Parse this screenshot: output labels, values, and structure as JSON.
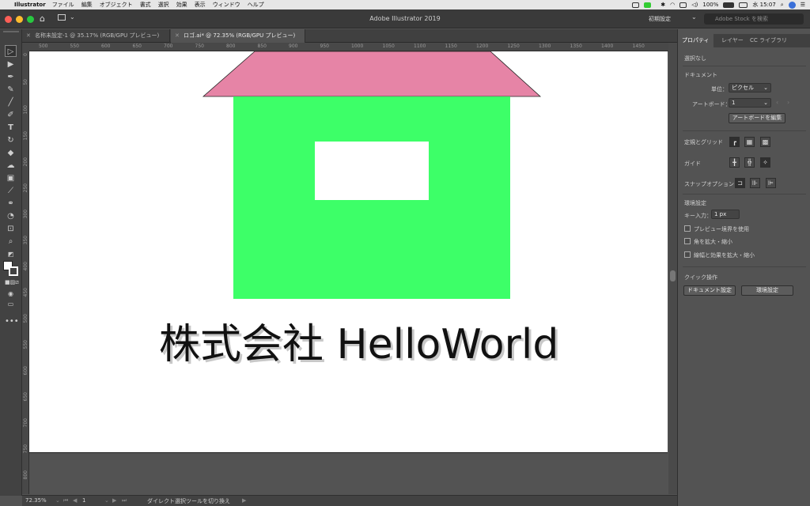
{
  "menubar": {
    "app_name": "Illustrator",
    "items": [
      "ファイル",
      "編集",
      "オブジェクト",
      "書式",
      "選択",
      "効果",
      "表示",
      "ウィンドウ",
      "ヘルプ"
    ],
    "battery": "100%",
    "clock": "水 15:07"
  },
  "window": {
    "title": "Adobe Illustrator 2019",
    "workspace": "初期設定",
    "stock_placeholder": "Adobe Stock を検索"
  },
  "tabs": [
    {
      "label": "名称未設定-1 @ 35.17% (RGB/GPU プレビュー)"
    },
    {
      "label": "ロゴ.ai* @ 72.35% (RGB/GPU プレビュー)"
    }
  ],
  "ruler": {
    "h": [
      "500",
      "550",
      "600",
      "650",
      "700",
      "750",
      "800",
      "850",
      "900",
      "950",
      "1000",
      "1050",
      "1100",
      "1150",
      "1200",
      "1250",
      "1300",
      "1350",
      "1400",
      "1450"
    ],
    "v": [
      "0",
      "50",
      "100",
      "150",
      "200",
      "250",
      "300",
      "350",
      "400",
      "450",
      "500",
      "550",
      "600",
      "650",
      "700",
      "750",
      "800"
    ]
  },
  "artwork": {
    "text": "株式会社 HelloWorld",
    "roof_color": "#e684a6",
    "wall_color": "#3dff68",
    "window_color": "#ffffff"
  },
  "status": {
    "zoom": "72.35%",
    "artboard": "1",
    "tool_hint": "ダイレクト選択ツールを切り換え"
  },
  "panel": {
    "tabs": [
      "プロパティ",
      "レイヤー",
      "CC ライブラリ"
    ],
    "selection": "選択なし",
    "document_heading": "ドキュメント",
    "unit_label": "単位：",
    "unit_value": "ピクセル",
    "artboard_label": "アートボード：",
    "artboard_value": "1",
    "edit_artboard": "アートボードを編集",
    "rulers_grid": "定規とグリッド",
    "guides": "ガイド",
    "snap": "スナップオプション",
    "prefs_heading": "環境設定",
    "key_input_label": "キー入力：",
    "key_input_value": "1 px",
    "opt_preview_bounds": "プレビュー境界を使用",
    "opt_scale_corners": "角を拡大・縮小",
    "opt_scale_strokes": "線幅と効果を拡大・縮小",
    "quick_actions": "クイック操作",
    "doc_settings": "ドキュメント設定",
    "env_settings": "環境設定"
  }
}
